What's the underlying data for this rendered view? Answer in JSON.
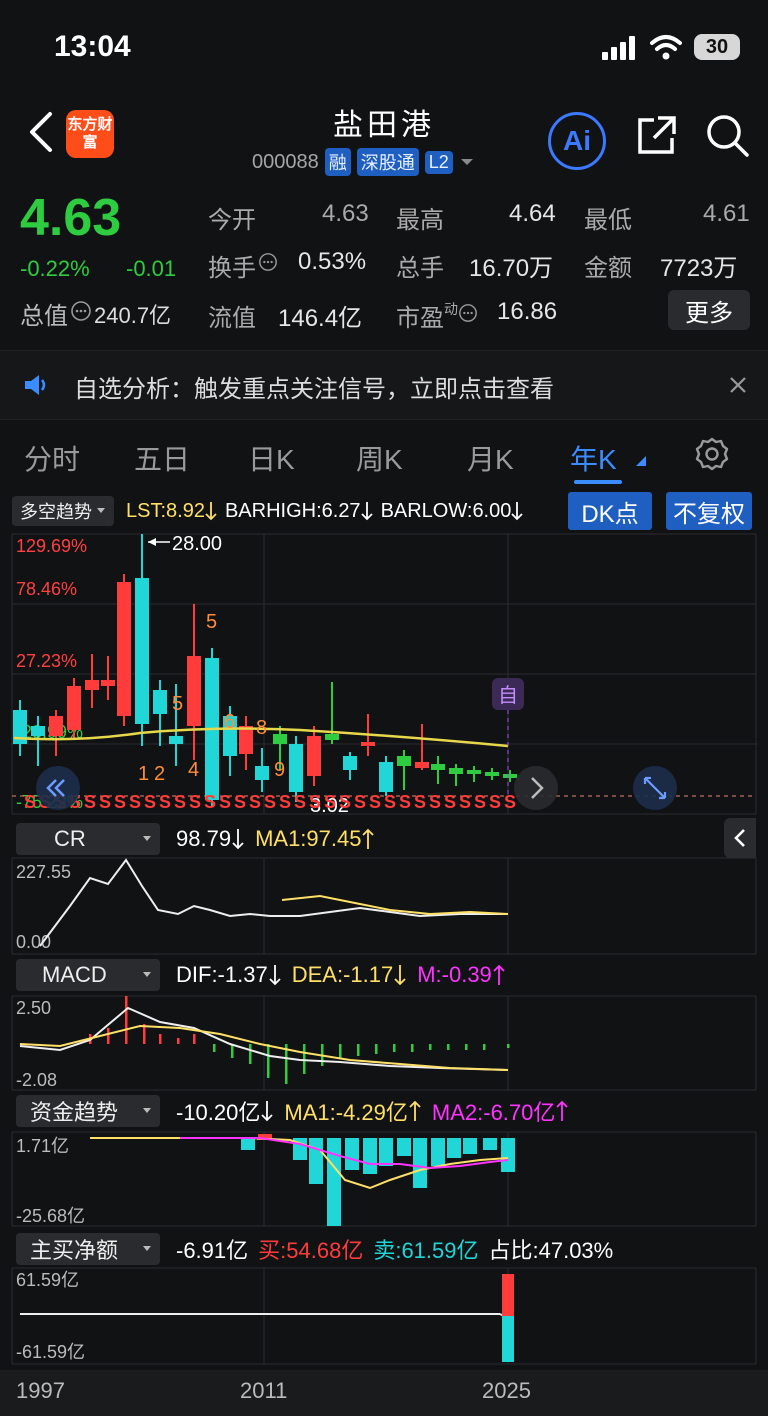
{
  "status": {
    "time": "13:04",
    "battery": "30"
  },
  "header": {
    "title": "盐田港",
    "code": "000088",
    "tags": [
      "融",
      "深股通",
      "L2"
    ],
    "ai_label": "Ai",
    "logo_text": "东方财富"
  },
  "quote": {
    "price": "4.63",
    "change_pct": "-0.22%",
    "change": "-0.01",
    "total_value_label": "总值",
    "total_value": "240.7亿",
    "stats": [
      {
        "label": "今开",
        "value": "4.63",
        "color": "green"
      },
      {
        "label": "最高",
        "value": "4.64",
        "color": "normal"
      },
      {
        "label": "最低",
        "value": "4.61",
        "color": "green"
      },
      {
        "label": "换手",
        "value": "0.53%",
        "color": "normal"
      },
      {
        "label": "总手",
        "value": "16.70万",
        "color": "normal"
      },
      {
        "label": "金额",
        "value": "7723万",
        "color": "normal"
      },
      {
        "label": "流值",
        "value": "146.4亿",
        "color": "normal"
      },
      {
        "label": "市盈",
        "label_sup": "动",
        "value": "16.86",
        "color": "normal"
      }
    ],
    "more_label": "更多"
  },
  "notice": {
    "text": "自选分析：触发重点关注信号，立即点击查看"
  },
  "tabs": [
    "分时",
    "五日",
    "日K",
    "周K",
    "月K",
    "年K"
  ],
  "active_tab": "年K",
  "main_indicator": {
    "selector": "多空趋势",
    "lst": "LST:8.92",
    "barhigh": "BARHIGH:6.27",
    "barlow": "BARLOW:6.00",
    "dk_label": "DK点",
    "fq_label": "不复权",
    "pct_labels": [
      "129.69%",
      "78.46%",
      "27.23%",
      "-23.99%",
      "-75.22%"
    ],
    "high_marker": "28.00",
    "low_marker": "3.02",
    "self_label": "自",
    "numbers": [
      "5",
      "5",
      "6",
      "8",
      "1",
      "2",
      "4",
      "9"
    ]
  },
  "cr": {
    "selector": "CR",
    "value": "98.79",
    "ma1": "MA1:97.45",
    "ymax": "227.55",
    "ymin": "0.00"
  },
  "macd": {
    "selector": "MACD",
    "dif": "DIF:-1.37",
    "dea": "DEA:-1.17",
    "m": "M:-0.39",
    "ymax": "2.50",
    "ymin": "-2.08"
  },
  "fund": {
    "selector": "资金趋势",
    "value": "-10.20亿",
    "ma1": "MA1:-4.29亿",
    "ma2": "MA2:-6.70亿",
    "ymax": "1.71亿",
    "ymin": "-25.68亿"
  },
  "net": {
    "selector": "主买净额",
    "value": "-6.91亿",
    "buy": "买:54.68亿",
    "sell": "卖:61.59亿",
    "ratio": "占比:47.03%",
    "ymax": "61.59亿",
    "ymin": "-61.59亿"
  },
  "xaxis": [
    "1997",
    "2011",
    "2025"
  ],
  "colors": {
    "up": "#ff3b3b",
    "down": "#20d6d6",
    "accent": "#3b8cff",
    "price_green": "#2ecc40",
    "ma_yellow": "#ffe066"
  },
  "chart_data": {
    "type": "bar",
    "categories": [
      "1997",
      "2011",
      "2025"
    ],
    "values": [
      129.69,
      -23.99,
      -75.22
    ],
    "ylim": [
      -75.22,
      129.69
    ]
  }
}
